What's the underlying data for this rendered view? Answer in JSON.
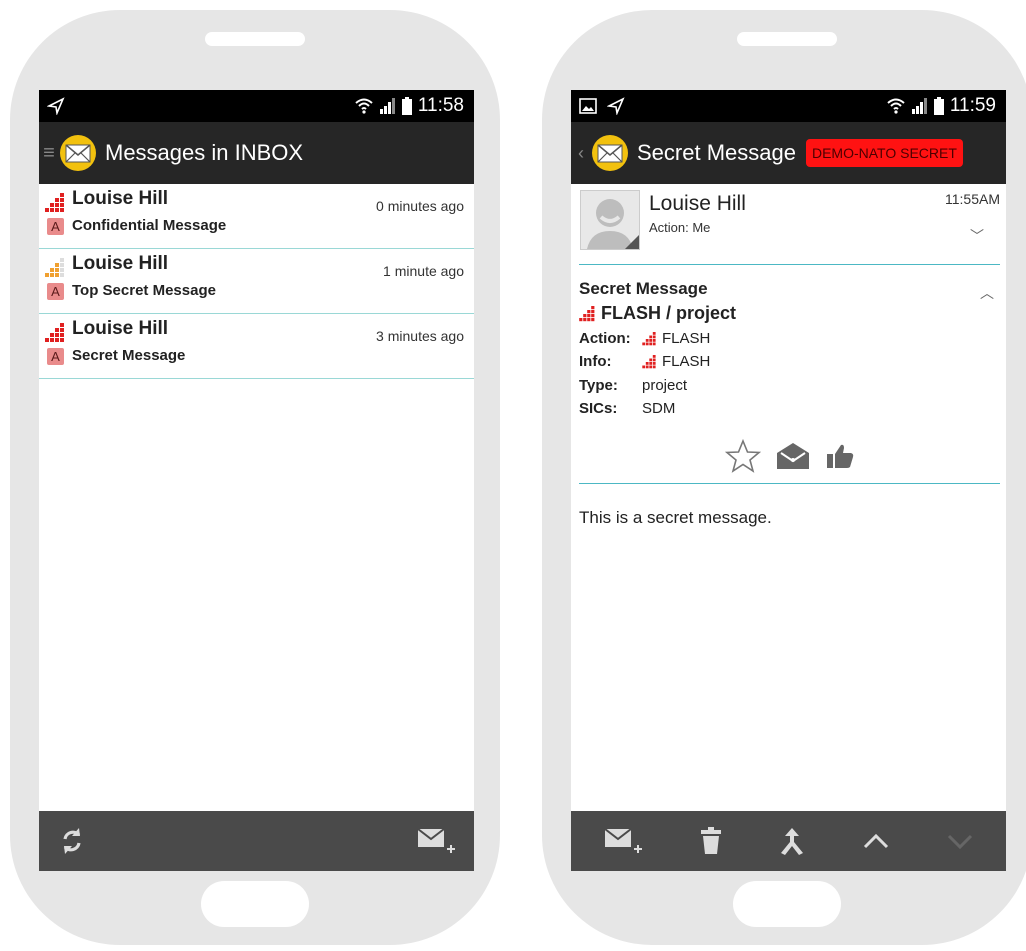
{
  "left_phone": {
    "status": {
      "time": "11:58",
      "icons": [
        "send-icon",
        "wifi-icon",
        "signal-icon",
        "battery-icon"
      ]
    },
    "app_bar": {
      "title": "Messages in INBOX",
      "nav_icon": "menu-icon",
      "logo": "mail-logo-icon"
    },
    "messages": [
      {
        "sender": "Louise Hill",
        "time": "0 minutes ago",
        "subject": "Confidential Message",
        "badge": "A",
        "priority_icon": "priority-flash-icon",
        "priority_color": "#e02020"
      },
      {
        "sender": "Louise Hill",
        "time": "1 minute ago",
        "subject": "Top Secret Message",
        "badge": "A",
        "priority_icon": "priority-immediate-icon",
        "priority_color": "#f0a030"
      },
      {
        "sender": "Louise Hill",
        "time": "3 minutes ago",
        "subject": "Secret Message",
        "badge": "A",
        "priority_icon": "priority-flash-icon",
        "priority_color": "#e02020"
      }
    ],
    "bottom_bar": {
      "icons": [
        "refresh-icon",
        "compose-icon"
      ]
    }
  },
  "right_phone": {
    "status": {
      "time": "11:59",
      "icons": [
        "image-icon",
        "send-icon",
        "wifi-icon",
        "signal-icon",
        "battery-icon"
      ]
    },
    "app_bar": {
      "title": "Secret Message",
      "nav_icon": "back-icon",
      "logo": "mail-logo-icon",
      "classification": "DEMO-NATO SECRET",
      "classification_color": "#ff1212"
    },
    "header": {
      "sender": "Louise Hill",
      "action": "Action: Me",
      "time": "11:55AM"
    },
    "meta": {
      "subject": "Secret Message",
      "priority_line": "FLASH / project",
      "rows": [
        {
          "key": "Action:",
          "value": "FLASH",
          "has_priority_icon": true
        },
        {
          "key": "Info:",
          "value": "FLASH",
          "has_priority_icon": true
        },
        {
          "key": "Type:",
          "value": "project",
          "has_priority_icon": false
        },
        {
          "key": "SICs:",
          "value": "SDM",
          "has_priority_icon": false
        }
      ],
      "actions": [
        "star-icon",
        "open-envelope-icon",
        "thumbs-up-icon"
      ]
    },
    "body": "This is a secret message.",
    "bottom_bar": {
      "icons": [
        "compose-icon",
        "trash-icon",
        "reply-all-icon",
        "previous-message-icon",
        "next-message-icon"
      ]
    }
  },
  "colors": {
    "accent_divider": "#4cb8c4",
    "bar_dark": "#262626",
    "bottom_bar": "#4a4a4a"
  }
}
